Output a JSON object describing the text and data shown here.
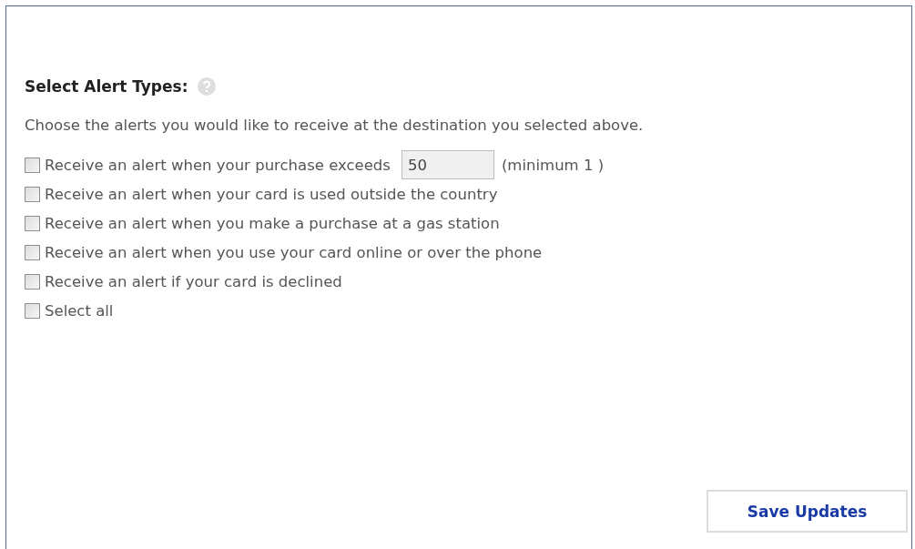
{
  "title": "Select Alert Types:",
  "description": "Choose the alerts you would like to receive at the destination you selected above.",
  "options": [
    {
      "kind": "amount",
      "label": "Receive an alert when your purchase exceeds",
      "checked": false,
      "value": "50",
      "note": "(minimum 1 )"
    },
    {
      "kind": "plain",
      "label": "Receive an alert when your card is used outside the country",
      "checked": false
    },
    {
      "kind": "plain",
      "label": "Receive an alert when you make a purchase at a gas station",
      "checked": false
    },
    {
      "kind": "plain",
      "label": "Receive an alert when you use your card online or over the phone",
      "checked": false
    },
    {
      "kind": "plain",
      "label": "Receive an alert if your card is declined",
      "checked": false
    },
    {
      "kind": "plain",
      "label": "Select all",
      "checked": false
    }
  ],
  "save_button": "Save Updates"
}
